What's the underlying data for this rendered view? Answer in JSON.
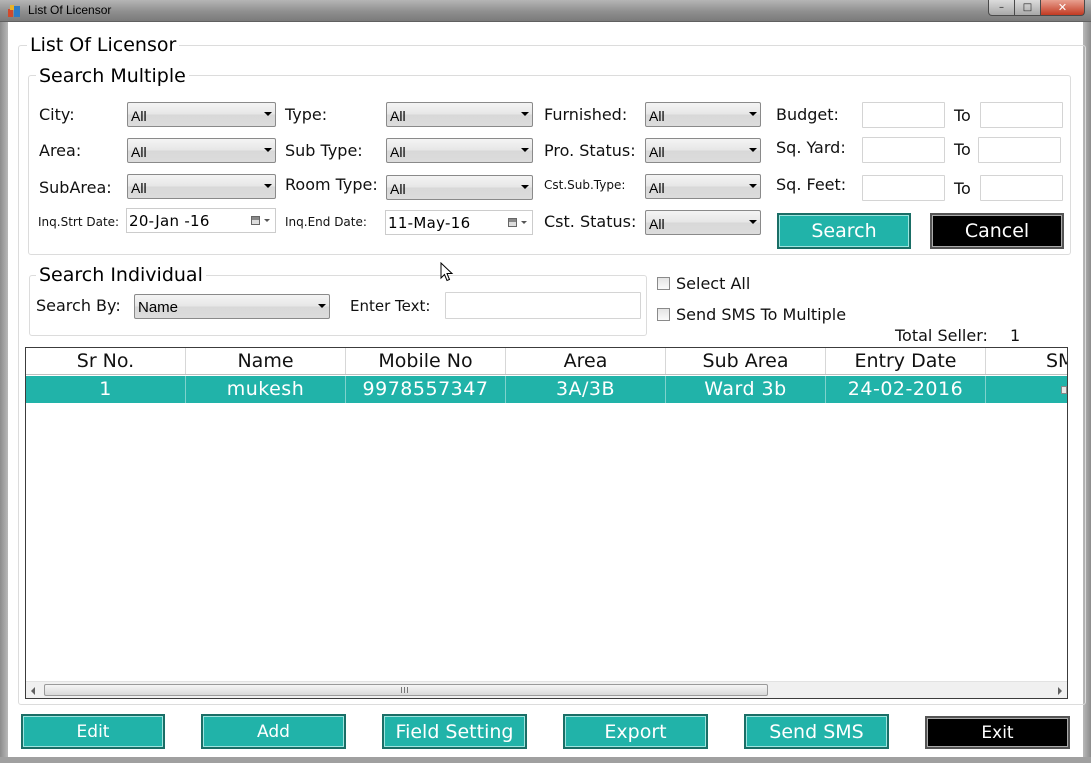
{
  "window": {
    "title": "List Of Licensor",
    "min_glyph": "–",
    "max_glyph": "□",
    "close_glyph": "✕"
  },
  "main_group": {
    "title": "List Of Licensor"
  },
  "search_multiple": {
    "title": "Search Multiple",
    "city_label": "City:",
    "city_value": "All",
    "type_label": "Type:",
    "type_value": "All",
    "furnished_label": "Furnished:",
    "furnished_value": "All",
    "budget_label": "Budget:",
    "budget_to_label": "To",
    "area_label": "Area:",
    "area_value": "All",
    "subtype_label": "Sub Type:",
    "subtype_value": "All",
    "prostatus_label": "Pro. Status:",
    "prostatus_value": "All",
    "sqyard_label": "Sq. Yard:",
    "sqyard_to_label": "To",
    "subarea_label": "SubArea:",
    "subarea_value": "All",
    "roomtype_label": "Room Type:",
    "roomtype_value": "All",
    "cstsubtype_label": "Cst.Sub.Type:",
    "cstsubtype_value": "All",
    "sqfeet_label": "Sq. Feet:",
    "sqfeet_to_label": "To",
    "inq_start_label": "Inq.Strt Date:",
    "inq_start_value": "20-Jan -16",
    "inq_end_label": "Inq.End Date:",
    "inq_end_value": "11-May-16",
    "cststatus_label": "Cst. Status:",
    "cststatus_value": "All",
    "search_button": "Search",
    "cancel_button": "Cancel"
  },
  "search_individual": {
    "title": "Search Individual",
    "search_by_label": "Search By:",
    "search_by_value": "Name",
    "enter_text_label": "Enter Text:",
    "enter_text_value": ""
  },
  "options": {
    "select_all_label": "Select All",
    "send_sms_multiple_label": "Send SMS To Multiple",
    "total_seller_label": "Total Seller:",
    "total_seller_value": "1"
  },
  "grid": {
    "columns": [
      "Sr No.",
      "Name",
      "Mobile No",
      "Area",
      "Sub Area",
      "Entry Date",
      "SMS"
    ],
    "rows": [
      {
        "sr_no": "1",
        "name": "mukesh",
        "mobile": "9978557347",
        "area": "3A/3B",
        "sub_area": "Ward 3b",
        "entry_date": "24-02-2016"
      }
    ]
  },
  "footer": {
    "edit": "Edit",
    "add": "Add",
    "field_setting": "Field Setting",
    "export": "Export",
    "send_sms": "Send SMS",
    "exit": "Exit"
  },
  "colors": {
    "accent": "#21b3a9",
    "dark_button": "#000000",
    "window_chrome": "#8f8f8f"
  }
}
